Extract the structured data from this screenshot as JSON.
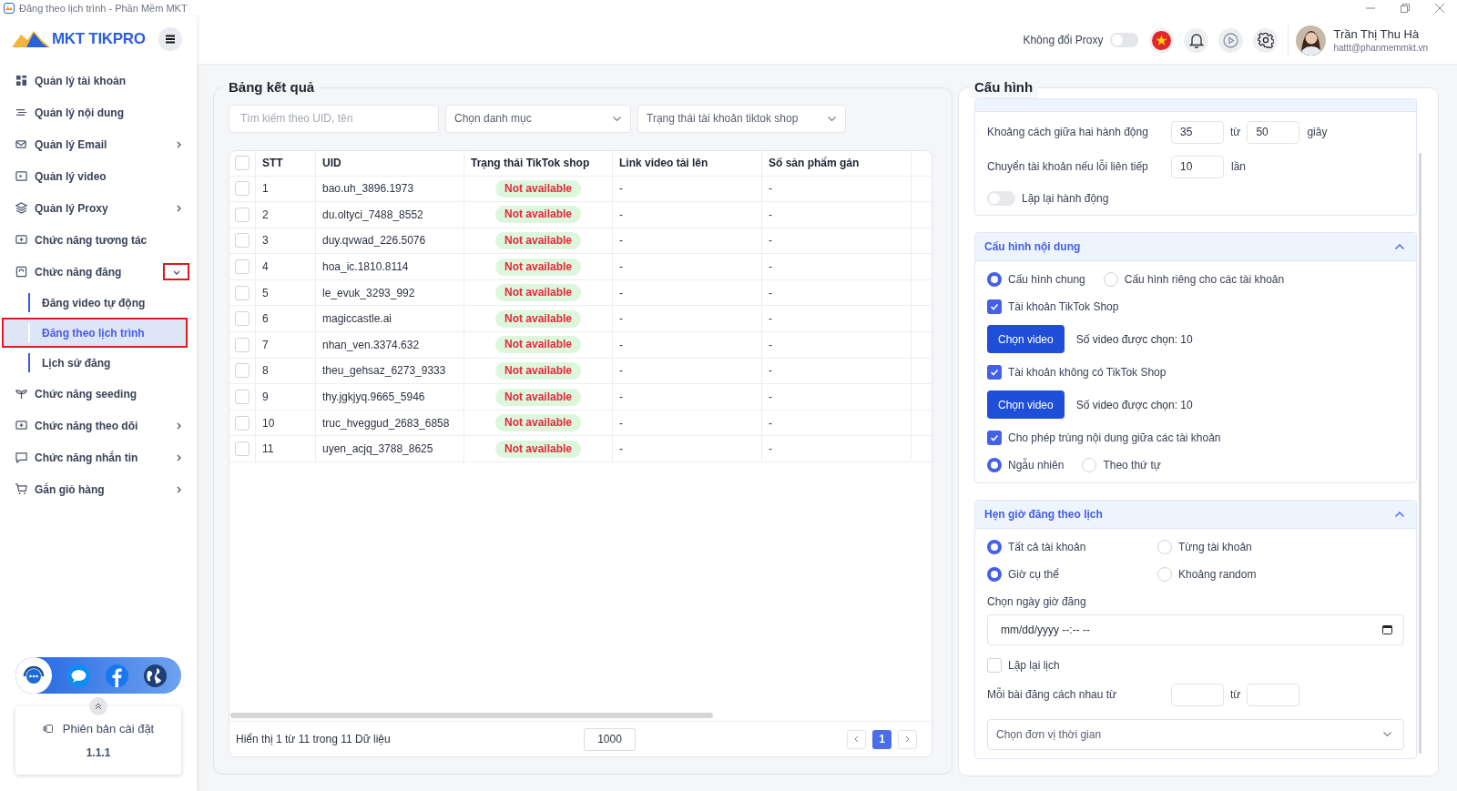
{
  "window": {
    "title": "Đăng theo lịch trình - Phần Mềm MKT"
  },
  "brand": {
    "logo_text": "MKT TIKPRO"
  },
  "sidebar": {
    "items": [
      {
        "label": "Quản lý tài khoản"
      },
      {
        "label": "Quản lý nội dung"
      },
      {
        "label": "Quản lý Email",
        "expanded": false
      },
      {
        "label": "Quản lý video"
      },
      {
        "label": "Quản lý Proxy",
        "expanded": false
      },
      {
        "label": "Chức năng tương tác"
      },
      {
        "label": "Chức năng đăng",
        "expanded": true,
        "annotated": true,
        "children": [
          {
            "label": "Đăng video tự động",
            "selected": false,
            "annotated": false
          },
          {
            "label": "Đăng theo lịch trình",
            "selected": true,
            "annotated": true
          },
          {
            "label": "Lịch sử đăng",
            "selected": false,
            "annotated": false
          }
        ]
      },
      {
        "label": "Chức năng seeding"
      },
      {
        "label": "Chức năng theo dõi",
        "expanded": false
      },
      {
        "label": "Chức năng nhắn tin",
        "expanded": false
      },
      {
        "label": "Gắn giỏ hàng",
        "expanded": false
      }
    ]
  },
  "version_card": {
    "label": "Phiên bản cài đặt",
    "version": "1.1.1"
  },
  "header": {
    "proxy_toggle": {
      "label": "Không đổi Proxy",
      "on": false
    },
    "user": {
      "name": "Trần Thị Thu Hà",
      "email": "hattt@phanmemmkt.vn"
    }
  },
  "results": {
    "title": "Bảng kết quả",
    "search": {
      "placeholder": "Tìm kiếm theo UID, tên"
    },
    "filters": [
      {
        "placeholder": "Chọn danh mục"
      },
      {
        "placeholder": "Trạng thái tài khoản tiktok shop"
      }
    ],
    "table": {
      "all_selected": false,
      "columns": [
        "STT",
        "UID",
        "Trạng thái TikTok shop",
        "Link video tải lên",
        "Số sản phẩm gán"
      ],
      "rows": [
        {
          "checked": false,
          "stt": "1",
          "uid": "bao.uh_3896.1973",
          "status": "Not available",
          "link": "-",
          "products": "-"
        },
        {
          "checked": false,
          "stt": "2",
          "uid": "du.oltyci_7488_8552",
          "status": "Not available",
          "link": "-",
          "products": "-"
        },
        {
          "checked": false,
          "stt": "3",
          "uid": "duy.qvwad_226.5076",
          "status": "Not available",
          "link": "-",
          "products": "-"
        },
        {
          "checked": false,
          "stt": "4",
          "uid": "hoa_ic.1810.8114",
          "status": "Not available",
          "link": "-",
          "products": "-"
        },
        {
          "checked": false,
          "stt": "5",
          "uid": "le_evuk_3293_992",
          "status": "Not available",
          "link": "-",
          "products": "-"
        },
        {
          "checked": false,
          "stt": "6",
          "uid": "magiccastle.ai",
          "status": "Not available",
          "link": "-",
          "products": "-"
        },
        {
          "checked": false,
          "stt": "7",
          "uid": "nhan_ven.3374.632",
          "status": "Not available",
          "link": "-",
          "products": "-"
        },
        {
          "checked": false,
          "stt": "8",
          "uid": "theu_gehsaz_6273_9333",
          "status": "Not available",
          "link": "-",
          "products": "-"
        },
        {
          "checked": false,
          "stt": "9",
          "uid": "thy.jgkjyq.9665_5946",
          "status": "Not available",
          "link": "-",
          "products": "-"
        },
        {
          "checked": false,
          "stt": "10",
          "uid": "truc_hveggud_2683_6858",
          "status": "Not available",
          "link": "-",
          "products": "-"
        },
        {
          "checked": false,
          "stt": "11",
          "uid": "uyen_acjq_3788_8625",
          "status": "Not available",
          "link": "-",
          "products": "-"
        }
      ]
    },
    "footer": {
      "summary": "Hiển thị 1 từ 11 trong 11 Dữ liệu",
      "page_size": "1000",
      "pages": [
        {
          "label": "1",
          "selected": true
        }
      ]
    }
  },
  "config": {
    "title": "Cấu hình",
    "sections": [
      {
        "items": [
          {
            "kind": "range",
            "label": "Khoảng cách giữa hai hành động",
            "value": "35",
            "sep": "từ",
            "value2": "50",
            "unit": "giây"
          },
          {
            "kind": "number",
            "label": "Chuyển tài khoản nếu lỗi liên tiếp",
            "value": "10",
            "unit": "lần"
          },
          {
            "kind": "toggle",
            "label": "Lặp lại hành động",
            "on": false
          }
        ]
      },
      {
        "title": "Cấu hình nội dung",
        "expanded": true,
        "items": [
          {
            "kind": "radios",
            "options": [
              {
                "label": "Cấu hình chung",
                "selected": true
              },
              {
                "label": "Cấu hình riêng cho các tài khoản",
                "selected": false
              }
            ]
          },
          {
            "kind": "checkbox",
            "label": "Tài khoản TikTok Shop",
            "checked": true
          },
          {
            "kind": "picker",
            "button": "Chọn video",
            "note": "Số video được chọn: 10"
          },
          {
            "kind": "checkbox",
            "label": "Tài khoản không có TikTok Shop",
            "checked": true
          },
          {
            "kind": "picker",
            "button": "Chọn video",
            "note": "Số video được chọn: 10"
          },
          {
            "kind": "checkbox",
            "label": "Cho phép trùng nội dung giữa các tài khoản",
            "checked": true
          },
          {
            "kind": "radios",
            "options": [
              {
                "label": "Ngẫu nhiên",
                "selected": true
              },
              {
                "label": "Theo thứ tự",
                "selected": false
              }
            ]
          }
        ]
      },
      {
        "title": "Hẹn giờ đăng theo lịch",
        "expanded": true,
        "items": [
          {
            "kind": "radio_grid",
            "options": [
              {
                "label": "Tất cả tài khoản",
                "selected": true
              },
              {
                "label": "Từng tài khoản",
                "selected": false
              }
            ]
          },
          {
            "kind": "radio_grid",
            "options": [
              {
                "label": "Giờ cụ thể",
                "selected": true
              },
              {
                "label": "Khoảng random",
                "selected": false
              }
            ]
          },
          {
            "kind": "label",
            "text": "Chọn ngày giờ đăng"
          },
          {
            "kind": "datetime",
            "placeholder": "mm/dd/yyyy --:-- --"
          },
          {
            "kind": "checkbox",
            "label": "Lặp lại lịch",
            "checked": false
          },
          {
            "kind": "range",
            "label": "Mỗi bài đăng cách nhau từ",
            "sep": "từ"
          },
          {
            "kind": "select",
            "placeholder": "Chọn đơn vị thời gian"
          }
        ]
      }
    ]
  }
}
